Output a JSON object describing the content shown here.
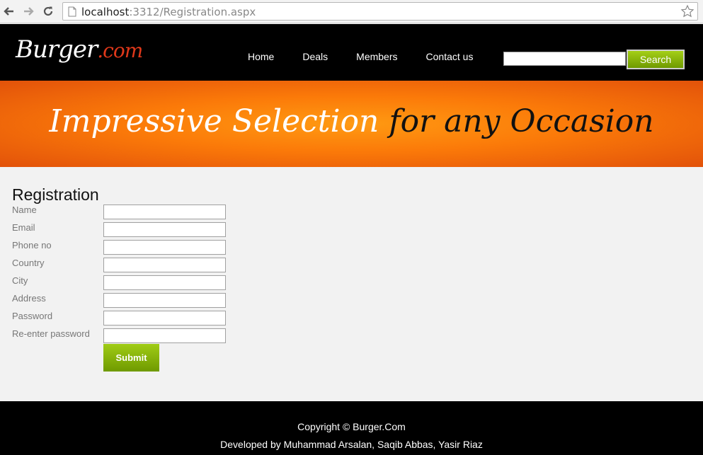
{
  "browser": {
    "url_host": "localhost",
    "url_rest": ":3312/Registration.aspx"
  },
  "header": {
    "logo_main": "Burger",
    "logo_accent": ".com",
    "menu": [
      {
        "label": "Home"
      },
      {
        "label": "Deals"
      },
      {
        "label": "Members"
      },
      {
        "label": "Contact us"
      }
    ],
    "search_button": "Search"
  },
  "banner": {
    "text_white": "Impressive Selection ",
    "text_black": "for any Occasion"
  },
  "form": {
    "title": "Registration",
    "fields": [
      {
        "label": "Name"
      },
      {
        "label": "Email"
      },
      {
        "label": "Phone no"
      },
      {
        "label": "Country"
      },
      {
        "label": "City"
      },
      {
        "label": "Address"
      },
      {
        "label": "Password"
      },
      {
        "label": "Re-enter password"
      }
    ],
    "submit": "Submit"
  },
  "footer": {
    "copyright": "Copyright © Burger.Com",
    "credits": "Developed by Muhammad Arsalan, Saqib Abbas, Yasir Riaz"
  },
  "colors": {
    "accent_green": "#8bb80a",
    "banner_orange": "#fb7a09",
    "logo_red": "#e0381a"
  }
}
